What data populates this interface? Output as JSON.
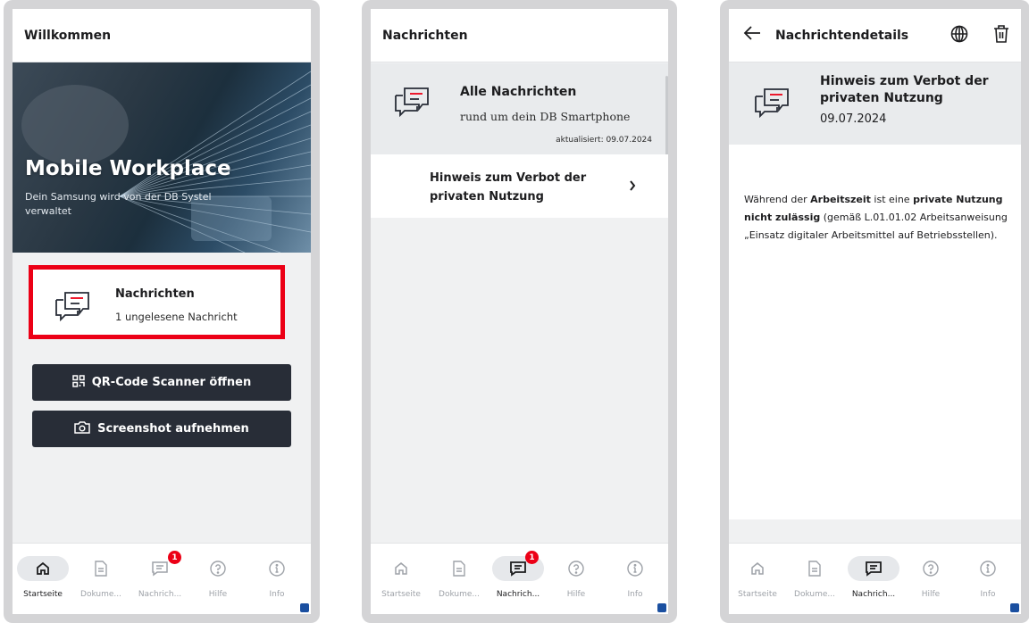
{
  "screen1": {
    "title": "Willkommen",
    "hero": {
      "title": "Mobile Workplace",
      "subtitle": "Dein Samsung wird von der DB Systel verwaltet"
    },
    "messages_card": {
      "title": "Nachrichten",
      "subtitle": "1 ungelesene Nachricht",
      "icon": "chat-icon"
    },
    "qr_button": {
      "label": "QR-Code Scanner öffnen",
      "icon": "qr-code-icon"
    },
    "screenshot_button": {
      "label": "Screenshot aufnehmen",
      "icon": "camera-icon"
    },
    "nav": {
      "items": [
        {
          "label": "Startseite",
          "icon": "home-icon"
        },
        {
          "label": "Dokume...",
          "icon": "document-icon"
        },
        {
          "label": "Nachrich...",
          "icon": "message-icon"
        },
        {
          "label": "Hilfe",
          "icon": "help-icon"
        },
        {
          "label": "Info",
          "icon": "info-icon"
        }
      ],
      "active": "Startseite",
      "badge": "1"
    }
  },
  "screen2": {
    "title": "Nachrichten",
    "all_messages": {
      "title": "Alle Nachrichten",
      "subtitle": "rund um dein DB Smartphone",
      "updated": "aktualisiert: 09.07.2024"
    },
    "items": [
      {
        "title": "Hinweis zum Verbot der privaten Nutzung"
      }
    ],
    "nav": {
      "items": [
        {
          "label": "Startseite",
          "icon": "home-icon"
        },
        {
          "label": "Dokume...",
          "icon": "document-icon"
        },
        {
          "label": "Nachrich...",
          "icon": "message-icon"
        },
        {
          "label": "Hilfe",
          "icon": "help-icon"
        },
        {
          "label": "Info",
          "icon": "info-icon"
        }
      ],
      "active": "Nachrich...",
      "badge": "1"
    }
  },
  "screen3": {
    "title": "Nachrichtendetails",
    "icons": [
      "back-arrow-icon",
      "globe-icon",
      "trash-icon"
    ],
    "header": {
      "title": "Hinweis zum Verbot der privaten Nutzung",
      "date": "09.07.2024"
    },
    "body": {
      "part1": "Während der ",
      "bold1": "Arbeitszeit",
      "part2": " ist eine ",
      "bold2": "private Nutzung nicht zulässig",
      "part3": " (gemäß L.01.01.02 Arbeitsanweisung „Einsatz digitaler Arbeitsmittel auf Betriebsstellen)."
    },
    "nav": {
      "items": [
        {
          "label": "Startseite",
          "icon": "home-icon"
        },
        {
          "label": "Dokume...",
          "icon": "document-icon"
        },
        {
          "label": "Nachrich...",
          "icon": "message-icon"
        },
        {
          "label": "Hilfe",
          "icon": "help-icon"
        },
        {
          "label": "Info",
          "icon": "info-icon"
        }
      ],
      "active": "Nachrich..."
    }
  },
  "colors": {
    "accent_red": "#ec0016",
    "dark_button": "#282d37",
    "panel_grey": "#e9ebed",
    "frame": "#d4d4d6"
  }
}
